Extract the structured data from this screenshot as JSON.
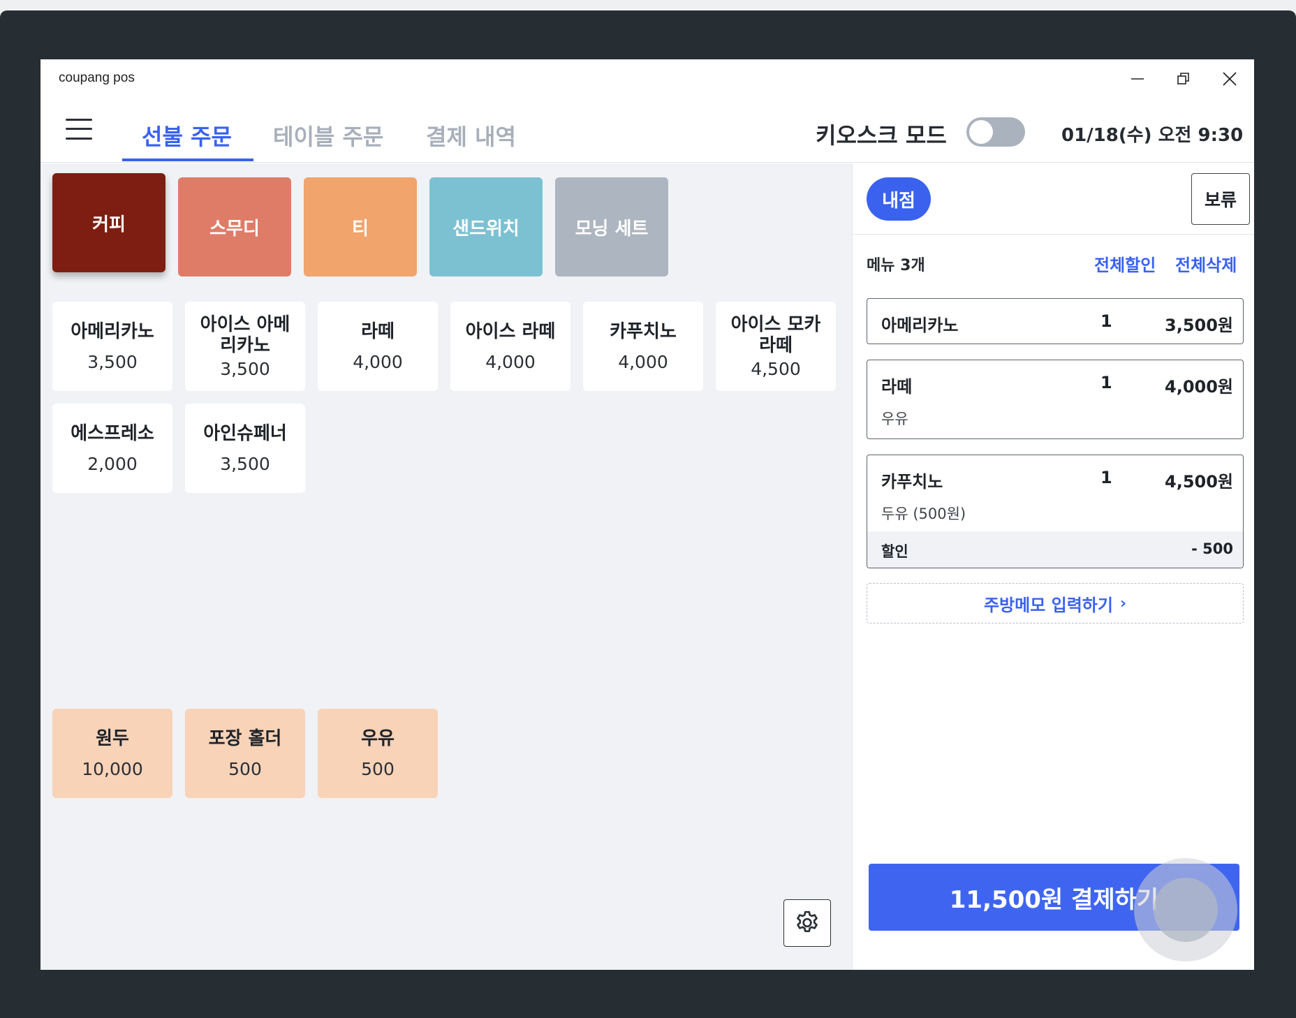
{
  "window": {
    "title": "coupang pos"
  },
  "header": {
    "tabs": [
      {
        "label": "선불 주문",
        "active": true
      },
      {
        "label": "테이블 주문",
        "active": false
      },
      {
        "label": "결제 내역",
        "active": false
      }
    ],
    "kiosk_label": "키오스크 모드",
    "kiosk_enabled": false,
    "datetime": "01/18(수) 오전 9:30"
  },
  "categories": [
    {
      "label": "커피",
      "color": "#7e1e12",
      "selected": true
    },
    {
      "label": "스무디",
      "color": "#df7c68",
      "selected": false
    },
    {
      "label": "티",
      "color": "#f1a46c",
      "selected": false
    },
    {
      "label": "샌드위치",
      "color": "#7cc1d2",
      "selected": false
    },
    {
      "label": "모닝 세트",
      "color": "#adb5c0",
      "selected": false
    }
  ],
  "menu_items": [
    {
      "name": "아메리카노",
      "price": "3,500"
    },
    {
      "name": "아이스 아메리카노",
      "price": "3,500"
    },
    {
      "name": "라떼",
      "price": "4,000"
    },
    {
      "name": "아이스 라떼",
      "price": "4,000"
    },
    {
      "name": "카푸치노",
      "price": "4,000"
    },
    {
      "name": "아이스 모카 라떼",
      "price": "4,500"
    },
    {
      "name": "에스프레소",
      "price": "2,000"
    },
    {
      "name": "아인슈페너",
      "price": "3,500"
    }
  ],
  "option_items": [
    {
      "name": "원두",
      "price": "10,000"
    },
    {
      "name": "포장 홀더",
      "price": "500"
    },
    {
      "name": "우유",
      "price": "500"
    }
  ],
  "order_panel": {
    "dine_in_label": "내점",
    "hold_label": "보류",
    "menu_count": "메뉴 3개",
    "discount_all_label": "전체할인",
    "delete_all_label": "전체삭제",
    "orders": [
      {
        "name": "아메리카노",
        "qty": "1",
        "price": "3,500원",
        "option": "",
        "discount_label": "",
        "discount": ""
      },
      {
        "name": "라떼",
        "qty": "1",
        "price": "4,000원",
        "option": "우유",
        "discount_label": "",
        "discount": ""
      },
      {
        "name": "카푸치노",
        "qty": "1",
        "price": "4,500원",
        "option": "두유 (500원)",
        "discount_label": "할인",
        "discount": "- 500"
      }
    ],
    "memo_label": "주방메모 입력하기",
    "pay_label": "11,500원 결제하기"
  },
  "colors": {
    "accent": "#3a62ef",
    "option_item_bg": "#f8d3b8",
    "device_frame": "#262d33"
  },
  "icons": {
    "minimize": "minimize-icon",
    "restore": "restore-icon",
    "close": "close-icon",
    "menu": "hamburger-menu-icon",
    "settings": "gear-icon"
  }
}
